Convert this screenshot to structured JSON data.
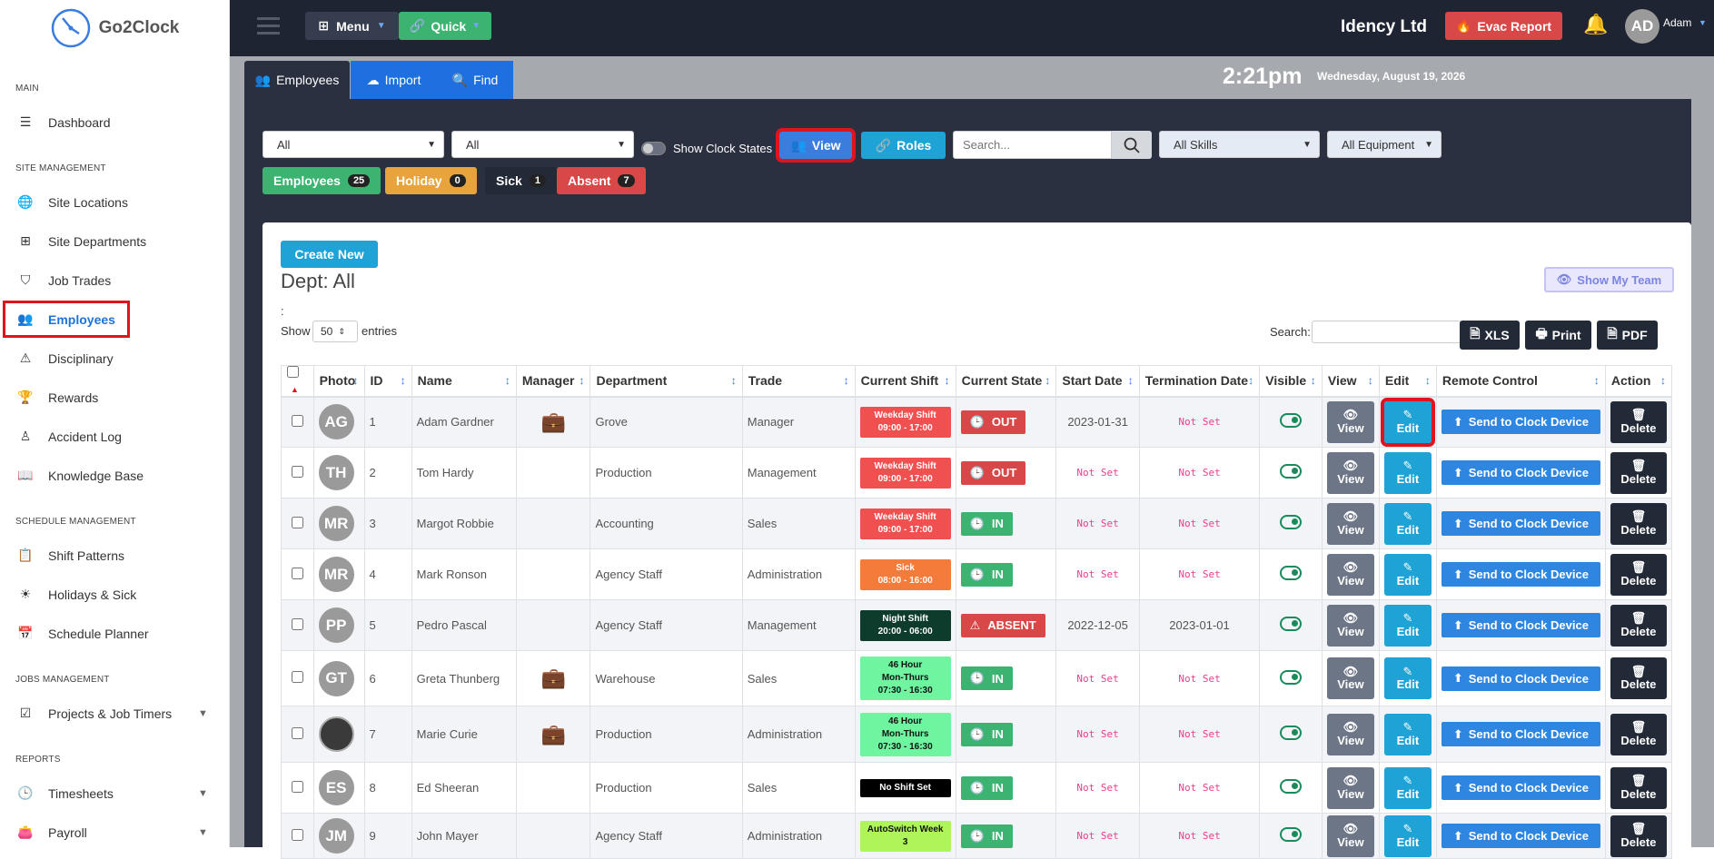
{
  "app": {
    "name": "Go2Clock"
  },
  "sidebar": {
    "sections": [
      {
        "title": "MAIN",
        "items": [
          {
            "label": "Dashboard",
            "icon": "sliders-icon"
          }
        ]
      },
      {
        "title": "SITE MANAGEMENT",
        "items": [
          {
            "label": "Site Locations",
            "icon": "globe-icon"
          },
          {
            "label": "Site Departments",
            "icon": "grid-icon"
          },
          {
            "label": "Job Trades",
            "icon": "shield-icon"
          },
          {
            "label": "Employees",
            "icon": "users-icon"
          },
          {
            "label": "Disciplinary",
            "icon": "alert-square-icon"
          },
          {
            "label": "Rewards",
            "icon": "trophy-icon"
          },
          {
            "label": "Accident Log",
            "icon": "person-icon"
          },
          {
            "label": "Knowledge Base",
            "icon": "book-icon"
          }
        ]
      },
      {
        "title": "SCHEDULE MANAGEMENT",
        "items": [
          {
            "label": "Shift Patterns",
            "icon": "clipboard-icon"
          },
          {
            "label": "Holidays & Sick",
            "icon": "sun-icon"
          },
          {
            "label": "Schedule Planner",
            "icon": "calendar-icon"
          }
        ]
      },
      {
        "title": "JOBS MANAGEMENT",
        "items": [
          {
            "label": "Projects & Job Timers",
            "icon": "check-square-icon"
          }
        ]
      },
      {
        "title": "REPORTS",
        "items": [
          {
            "label": "Timesheets",
            "icon": "clock-icon"
          },
          {
            "label": "Payroll",
            "icon": "wallet-icon"
          }
        ]
      }
    ]
  },
  "topbar": {
    "menu_label": "Menu",
    "quick_label": "Quick",
    "company": "Idency Ltd",
    "evac_label": "Evac Report",
    "user_initials": "AD",
    "user_name": "Adam"
  },
  "tabs": [
    {
      "label": "Employees"
    },
    {
      "label": "Import"
    },
    {
      "label": "Find"
    }
  ],
  "clock": {
    "time": "2:21pm",
    "date": "Wednesday, August 19, 2026"
  },
  "filters": {
    "site": "All",
    "dept": "All",
    "show_clock_states": "Show Clock States",
    "view_label": "View",
    "roles_label": "Roles",
    "search_placeholder": "Search...",
    "skills": "All Skills",
    "equipment": "All Equipment"
  },
  "stats": [
    {
      "label": "Employees",
      "count": "25",
      "color": "#3cb371"
    },
    {
      "label": "Holiday",
      "count": "0",
      "color": "#e8a33d"
    },
    {
      "label": "Sick",
      "count": "1",
      "color": "#222a38"
    },
    {
      "label": "Absent",
      "count": "7",
      "color": "#d94848"
    }
  ],
  "card": {
    "create_label": "Create New",
    "dept_title": "Dept: All",
    "colon": ":",
    "show_label": "Show",
    "entries_value": "50",
    "entries_label": "entries",
    "search_label": "Search:",
    "xls_label": "XLS",
    "print_label": "Print",
    "pdf_label": "PDF",
    "show_team_label": "Show My Team"
  },
  "table": {
    "headers": [
      "Photo",
      "ID",
      "Name",
      "Manager",
      "Department",
      "Trade",
      "Current Shift",
      "Current State",
      "Start Date",
      "Termination Date",
      "Visible",
      "View",
      "Edit",
      "Remote Control",
      "Action"
    ],
    "view_label": "View",
    "edit_label": "Edit",
    "send_label": "Send to Clock Device",
    "delete_label": "Delete",
    "rows": [
      {
        "initials": "AG",
        "id": "1",
        "name": "Adam Gardner",
        "manager": true,
        "dept": "Grove",
        "trade": "Manager",
        "shift": [
          "Weekday Shift",
          "09:00 - 17:00"
        ],
        "shift_color": "#f05050",
        "state": "OUT",
        "state_color": "#d94848",
        "start": "2023-01-31",
        "term": "Not Set"
      },
      {
        "initials": "TH",
        "id": "2",
        "name": "Tom Hardy",
        "manager": false,
        "dept": "Production",
        "trade": "Management",
        "shift": [
          "Weekday Shift",
          "09:00 - 17:00"
        ],
        "shift_color": "#f05050",
        "state": "OUT",
        "state_color": "#d94848",
        "start": "Not Set",
        "term": "Not Set"
      },
      {
        "initials": "MR",
        "id": "3",
        "name": "Margot Robbie",
        "manager": false,
        "dept": "Accounting",
        "trade": "Sales",
        "shift": [
          "Weekday Shift",
          "09:00 - 17:00"
        ],
        "shift_color": "#f05050",
        "state": "IN",
        "state_color": "#3cb371",
        "start": "Not Set",
        "term": "Not Set"
      },
      {
        "initials": "MR",
        "id": "4",
        "name": "Mark Ronson",
        "manager": false,
        "dept": "Agency Staff",
        "trade": "Administration",
        "shift": [
          "Sick",
          "08:00 - 16:00"
        ],
        "shift_color": "#f47b3a",
        "state": "IN",
        "state_color": "#3cb371",
        "start": "Not Set",
        "term": "Not Set"
      },
      {
        "initials": "PP",
        "id": "5",
        "name": "Pedro Pascal",
        "manager": false,
        "dept": "Agency Staff",
        "trade": "Management",
        "shift": [
          "Night Shift",
          "20:00 - 06:00"
        ],
        "shift_color": "#0d3b2c",
        "state": "ABSENT",
        "state_color": "#d94848",
        "start": "2022-12-05",
        "term": "2023-01-01"
      },
      {
        "initials": "GT",
        "id": "6",
        "name": "Greta Thunberg",
        "manager": true,
        "dept": "Warehouse",
        "trade": "Sales",
        "shift": [
          "46 Hour",
          "Mon-Thurs",
          "07:30 - 16:30"
        ],
        "shift_color": "#6ff5a0",
        "state": "IN",
        "state_color": "#3cb371",
        "start": "Not Set",
        "term": "Not Set"
      },
      {
        "initials": "",
        "id": "7",
        "name": "Marie Curie",
        "manager": true,
        "dept": "Production",
        "trade": "Administration",
        "shift": [
          "46 Hour",
          "Mon-Thurs",
          "07:30 - 16:30"
        ],
        "shift_color": "#6ff5a0",
        "state": "IN",
        "state_color": "#3cb371",
        "start": "Not Set",
        "term": "Not Set"
      },
      {
        "initials": "ES",
        "id": "8",
        "name": "Ed Sheeran",
        "manager": false,
        "dept": "Production",
        "trade": "Sales",
        "shift": [
          "No Shift Set"
        ],
        "shift_color": "#000000",
        "state": "IN",
        "state_color": "#3cb371",
        "start": "Not Set",
        "term": "Not Set"
      },
      {
        "initials": "JM",
        "id": "9",
        "name": "John Mayer",
        "manager": false,
        "dept": "Agency Staff",
        "trade": "Administration",
        "shift": [
          "AutoSwitch Week",
          "3"
        ],
        "shift_color": "#aef55a",
        "state": "IN",
        "state_color": "#3cb371",
        "start": "Not Set",
        "term": "Not Set"
      }
    ]
  }
}
